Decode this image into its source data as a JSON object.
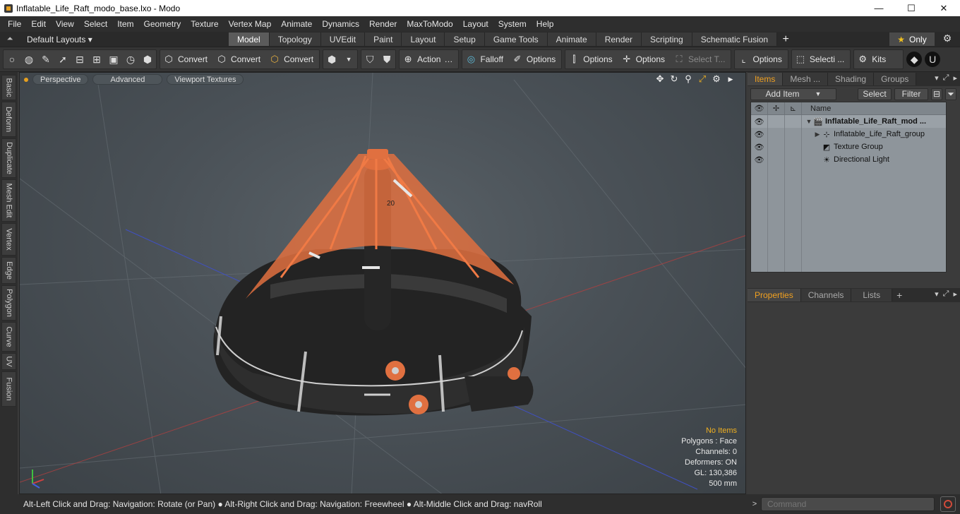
{
  "window": {
    "title": "Inflatable_Life_Raft_modo_base.lxo - Modo",
    "minimize": "—",
    "maximize": "☐",
    "close": "✕"
  },
  "menu": [
    "File",
    "Edit",
    "View",
    "Select",
    "Item",
    "Geometry",
    "Texture",
    "Vertex Map",
    "Animate",
    "Dynamics",
    "Render",
    "MaxToModo",
    "Layout",
    "System",
    "Help"
  ],
  "layout_bar": {
    "layout_select": "Default Layouts ▾",
    "tabs": [
      "Model",
      "Topology",
      "UVEdit",
      "Paint",
      "Layout",
      "Setup",
      "Game Tools",
      "Animate",
      "Render",
      "Scripting",
      "Schematic Fusion"
    ],
    "active_tab": "Model",
    "add": "+",
    "only_label": "Only",
    "only_star": "★"
  },
  "toolbar": {
    "convert_1": "Convert",
    "convert_2": "Convert",
    "convert_3": "Convert",
    "action": "Action",
    "action_more": "…",
    "falloff": "Falloff",
    "options_1": "Options",
    "options_2": "Options",
    "options_3": "Options",
    "select_t": "Select T...",
    "options_4": "Options",
    "selecti": "Selecti ...",
    "kits": "Kits"
  },
  "left_tabs": [
    "Basic",
    "Deform",
    "Duplicate",
    "Mesh Edit",
    "Vertex",
    "Edge",
    "Polygon",
    "Curve",
    "UV",
    "Fusion"
  ],
  "viewport": {
    "perspective": "Perspective",
    "advanced": "Advanced",
    "viewport_textures": "Viewport Textures",
    "decal_text": "20",
    "stats": {
      "selection": "No Items",
      "polygons": "Polygons : Face",
      "channels": "Channels: 0",
      "deformers": "Deformers: ON",
      "gl": "GL: 130,386",
      "scale": "500 mm"
    }
  },
  "items_panel": {
    "tabs": [
      "Items",
      "Mesh ...",
      "Shading",
      "Groups"
    ],
    "active_tab": "Items",
    "add_item": "Add Item",
    "select": "Select",
    "filter": "Filter",
    "name_header": "Name",
    "rows": [
      {
        "label": "Inflatable_Life_Raft_mod ...",
        "icon": "🎬",
        "arrow": "▼",
        "indent": 0,
        "bold": true
      },
      {
        "label": "Inflatable_Life_Raft_group",
        "icon": "⊹",
        "arrow": "▶",
        "indent": 1,
        "bold": false
      },
      {
        "label": "Texture Group",
        "icon": "◩",
        "arrow": "",
        "indent": 1,
        "bold": false
      },
      {
        "label": "Directional Light",
        "icon": "☀",
        "arrow": "",
        "indent": 1,
        "bold": false
      }
    ]
  },
  "properties_panel": {
    "tabs": [
      "Properties",
      "Channels",
      "Lists"
    ],
    "active_tab": "Properties",
    "add": "+"
  },
  "status_bar": {
    "hint": "Alt-Left Click and Drag: Navigation: Rotate (or Pan) ● Alt-Right Click and Drag: Navigation: Freewheel ● Alt-Middle Click and Drag: navRoll"
  },
  "command": {
    "arrow": ">",
    "placeholder": "Command"
  },
  "colors": {
    "accent": "#f0a020",
    "raft_orange": "#e07040",
    "raft_body": "#2b2b2b"
  }
}
